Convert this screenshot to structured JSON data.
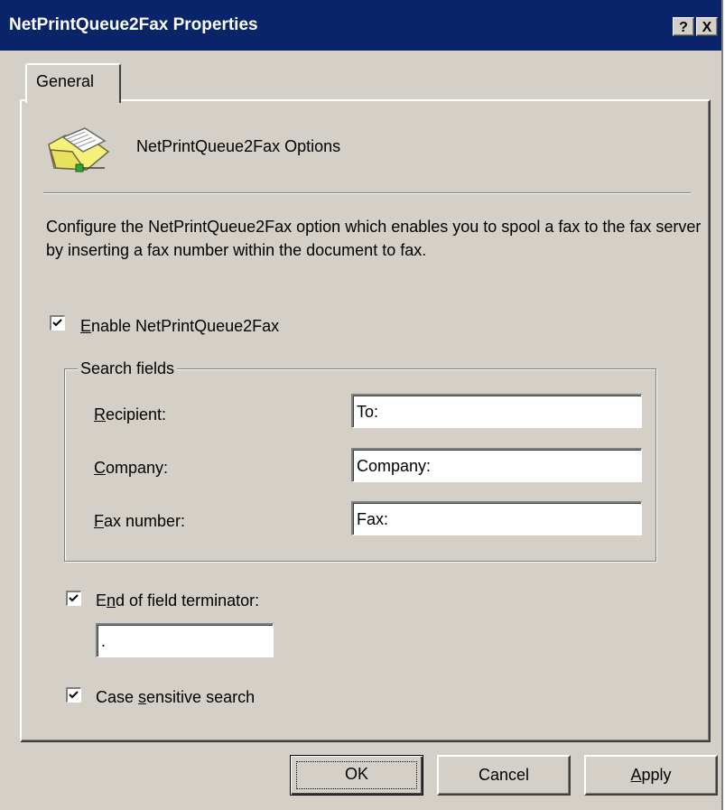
{
  "window": {
    "title": "NetPrintQueue2Fax Properties",
    "help_glyph": "?",
    "close_glyph": "X"
  },
  "tabs": [
    {
      "label": "General"
    }
  ],
  "header": {
    "icon": "folder-printer-icon",
    "title": "NetPrintQueue2Fax Options"
  },
  "description": "Configure the NetPrintQueue2Fax option which enables you to spool a fax to the fax server by inserting a fax number within the document to fax.",
  "enable": {
    "checked": true,
    "mnemonic": "E",
    "label_rest": "nable NetPrintQueue2Fax"
  },
  "search_fields": {
    "title": "Search fields",
    "fields": [
      {
        "mnemonic": "R",
        "label_rest": "ecipient:",
        "value": "To:"
      },
      {
        "mnemonic": "C",
        "label_rest": "ompany:",
        "value": "Company:"
      },
      {
        "mnemonic": "F",
        "label_rest": "ax number:",
        "value": "Fax:"
      }
    ]
  },
  "terminator": {
    "checked": true,
    "label_pre": "E",
    "mnemonic": "n",
    "label_rest": "d of field terminator:",
    "value": "."
  },
  "case_sensitive": {
    "checked": true,
    "label_pre": "Case ",
    "mnemonic": "s",
    "label_rest": "ensitive search"
  },
  "buttons": {
    "ok": "OK",
    "cancel": "Cancel",
    "apply_mnemonic": "A",
    "apply_rest": "pply"
  },
  "colors": {
    "titlebar": "#0a246a",
    "face": "#d4d0c8"
  }
}
